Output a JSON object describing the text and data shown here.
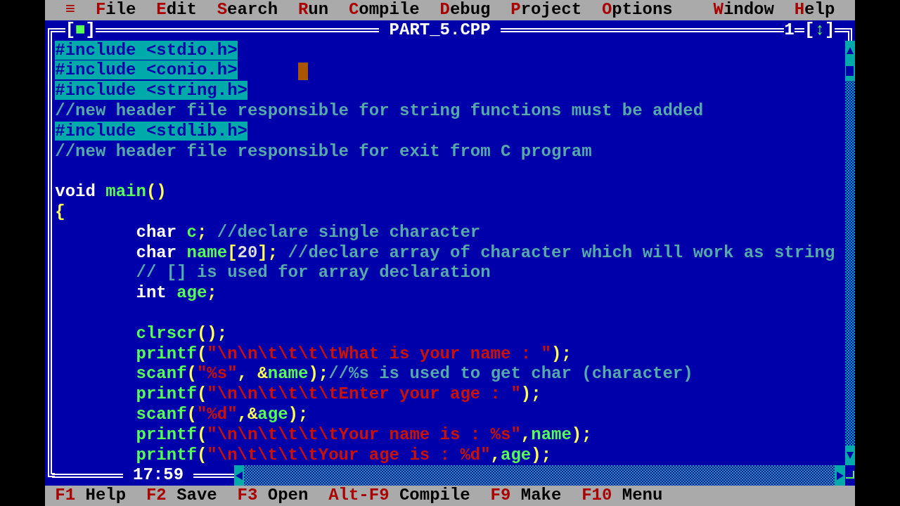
{
  "menu_bar": {
    "items": [
      {
        "label": "≡"
      },
      {
        "label": "File"
      },
      {
        "label": "Edit"
      },
      {
        "label": "Search"
      },
      {
        "label": "Run"
      },
      {
        "label": "Compile"
      },
      {
        "label": "Debug"
      },
      {
        "label": "Project"
      },
      {
        "label": "Options"
      },
      {
        "label": "Window",
        "kind": "right"
      },
      {
        "label": "Help",
        "kind": "right"
      }
    ]
  },
  "editor": {
    "close_button": "[■]",
    "title": "PART_5.CPP",
    "window_number": "1",
    "zoom_button": "[↕]",
    "cursor_position": "17:59",
    "lines": [
      {
        "blank_line_before": false,
        "indent": false,
        "cursor": false,
        "tokens": [
          {
            "kind": "preprocessor",
            "text": "#include <stdio.h>"
          }
        ]
      },
      {
        "blank_line_before": false,
        "indent": false,
        "cursor": true,
        "tokens": [
          {
            "kind": "preprocessor",
            "text": "#include <conio.h>"
          }
        ]
      },
      {
        "blank_line_before": false,
        "indent": false,
        "cursor": false,
        "tokens": [
          {
            "kind": "preprocessor",
            "text": "#include <string.h>"
          }
        ]
      },
      {
        "blank_line_before": false,
        "indent": false,
        "cursor": false,
        "tokens": [
          {
            "kind": "comment",
            "text": "//new header file responsible for string functions must be added"
          }
        ]
      },
      {
        "blank_line_before": false,
        "indent": false,
        "cursor": false,
        "tokens": [
          {
            "kind": "preprocessor",
            "text": "#include <stdlib.h>"
          }
        ]
      },
      {
        "blank_line_before": false,
        "indent": false,
        "cursor": false,
        "tokens": [
          {
            "kind": "comment",
            "text": "//new header file responsible for exit from C program"
          }
        ]
      },
      {
        "blank_line_before": true,
        "indent": false,
        "cursor": false,
        "tokens": [
          {
            "kind": "keyword",
            "text": "void"
          },
          {
            "kind": "identifier",
            "text": " main"
          },
          {
            "kind": "symbol",
            "text": "()"
          }
        ]
      },
      {
        "blank_line_before": false,
        "indent": false,
        "cursor": false,
        "tokens": [
          {
            "kind": "symbol",
            "text": "{"
          }
        ]
      },
      {
        "blank_line_before": false,
        "indent": true,
        "cursor": false,
        "tokens": [
          {
            "kind": "keyword",
            "text": "char"
          },
          {
            "kind": "identifier",
            "text": " c"
          },
          {
            "kind": "symbol",
            "text": ";"
          },
          {
            "kind": "comment",
            "text": " //declare single character"
          }
        ]
      },
      {
        "blank_line_before": false,
        "indent": true,
        "cursor": false,
        "tokens": [
          {
            "kind": "keyword",
            "text": "char"
          },
          {
            "kind": "identifier",
            "text": " name"
          },
          {
            "kind": "symbol",
            "text": "["
          },
          {
            "kind": "number",
            "text": "20"
          },
          {
            "kind": "symbol",
            "text": "];"
          },
          {
            "kind": "comment",
            "text": " //declare array of character which will work as string"
          }
        ]
      },
      {
        "blank_line_before": false,
        "indent": true,
        "cursor": false,
        "tokens": [
          {
            "kind": "comment",
            "text": "// [] is used for array declaration"
          }
        ]
      },
      {
        "blank_line_before": false,
        "indent": true,
        "cursor": false,
        "tokens": [
          {
            "kind": "keyword",
            "text": "int"
          },
          {
            "kind": "identifier",
            "text": " age"
          },
          {
            "kind": "symbol",
            "text": ";"
          }
        ]
      },
      {
        "blank_line_before": true,
        "indent": true,
        "cursor": false,
        "tokens": [
          {
            "kind": "identifier",
            "text": "clrscr"
          },
          {
            "kind": "symbol",
            "text": "();"
          }
        ]
      },
      {
        "blank_line_before": false,
        "indent": true,
        "cursor": false,
        "tokens": [
          {
            "kind": "identifier",
            "text": "printf"
          },
          {
            "kind": "symbol",
            "text": "("
          },
          {
            "kind": "string",
            "text": "\"\\n\\n\\t\\t\\t\\tWhat is your name : \""
          },
          {
            "kind": "symbol",
            "text": ");"
          }
        ]
      },
      {
        "blank_line_before": false,
        "indent": true,
        "cursor": false,
        "tokens": [
          {
            "kind": "identifier",
            "text": "scanf"
          },
          {
            "kind": "symbol",
            "text": "("
          },
          {
            "kind": "string",
            "text": "\"%s\""
          },
          {
            "kind": "symbol",
            "text": ", &"
          },
          {
            "kind": "identifier",
            "text": "name"
          },
          {
            "kind": "symbol",
            "text": ");"
          },
          {
            "kind": "comment",
            "text": "//%s is used to get char (character)"
          }
        ]
      },
      {
        "blank_line_before": false,
        "indent": true,
        "cursor": false,
        "tokens": [
          {
            "kind": "identifier",
            "text": "printf"
          },
          {
            "kind": "symbol",
            "text": "("
          },
          {
            "kind": "string",
            "text": "\"\\n\\n\\t\\t\\t\\tEnter your age : \""
          },
          {
            "kind": "symbol",
            "text": ");"
          }
        ]
      },
      {
        "blank_line_before": false,
        "indent": true,
        "cursor": false,
        "tokens": [
          {
            "kind": "identifier",
            "text": "scanf"
          },
          {
            "kind": "symbol",
            "text": "("
          },
          {
            "kind": "string",
            "text": "\"%d\""
          },
          {
            "kind": "symbol",
            "text": ",&"
          },
          {
            "kind": "identifier",
            "text": "age"
          },
          {
            "kind": "symbol",
            "text": ");"
          }
        ]
      },
      {
        "blank_line_before": false,
        "indent": true,
        "cursor": false,
        "tokens": [
          {
            "kind": "identifier",
            "text": "printf"
          },
          {
            "kind": "symbol",
            "text": "("
          },
          {
            "kind": "string",
            "text": "\"\\n\\n\\t\\t\\t\\tYour name is : %s\""
          },
          {
            "kind": "symbol",
            "text": ","
          },
          {
            "kind": "identifier",
            "text": "name"
          },
          {
            "kind": "symbol",
            "text": ");"
          }
        ]
      },
      {
        "blank_line_before": false,
        "indent": true,
        "cursor": false,
        "tokens": [
          {
            "kind": "identifier",
            "text": "printf"
          },
          {
            "kind": "symbol",
            "text": "("
          },
          {
            "kind": "string",
            "text": "\"\\n\\t\\t\\t\\tYour age is : %d\""
          },
          {
            "kind": "symbol",
            "text": ","
          },
          {
            "kind": "identifier",
            "text": "age"
          },
          {
            "kind": "symbol",
            "text": ");"
          }
        ]
      }
    ]
  },
  "status_bar": {
    "items": [
      {
        "key": "F1",
        "label": "Help"
      },
      {
        "key": "F2",
        "label": "Save"
      },
      {
        "key": "F3",
        "label": "Open"
      },
      {
        "key": "Alt-F9",
        "label": "Compile"
      },
      {
        "key": "F9",
        "label": "Make"
      },
      {
        "key": "F10",
        "label": "Menu"
      }
    ]
  }
}
